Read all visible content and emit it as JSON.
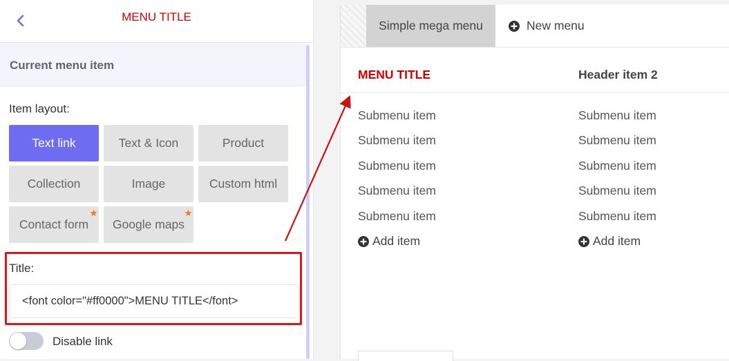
{
  "header": {
    "title": "MENU TITLE",
    "title_color": "#d10000",
    "back_icon": "chevron-left-icon"
  },
  "section": {
    "label": "Current menu item"
  },
  "layout": {
    "label": "Item layout:",
    "options": [
      {
        "label": "Text link",
        "active": true
      },
      {
        "label": "Text & Icon"
      },
      {
        "label": "Product"
      },
      {
        "label": "Collection"
      },
      {
        "label": "Image"
      },
      {
        "label": "Custom html"
      },
      {
        "label": "Contact form",
        "badge": "star-icon"
      },
      {
        "label": "Google maps",
        "badge": "star-icon"
      }
    ]
  },
  "title_field": {
    "label": "Title:",
    "value": "<font color=\"#ff0000\">MENU TITLE</font>"
  },
  "disable_link": {
    "label": "Disable link",
    "enabled": false
  },
  "tabs": {
    "active": "Simple mega menu",
    "new": "New menu"
  },
  "menu": {
    "columns": [
      {
        "header": "MENU TITLE",
        "header_color": "#d10000",
        "items": [
          "Submenu item",
          "Submenu item",
          "Submenu item",
          "Submenu item",
          "Submenu item"
        ],
        "add_label": "Add item"
      },
      {
        "header": "Header item 2",
        "header_color": "#444444",
        "items": [
          "Submenu item",
          "Submenu item",
          "Submenu item",
          "Submenu item",
          "Submenu item"
        ],
        "add_label": "Add item"
      }
    ]
  },
  "colors": {
    "accent": "#6e6cf0",
    "highlight_border": "#e01414",
    "star": "#f57c23"
  }
}
